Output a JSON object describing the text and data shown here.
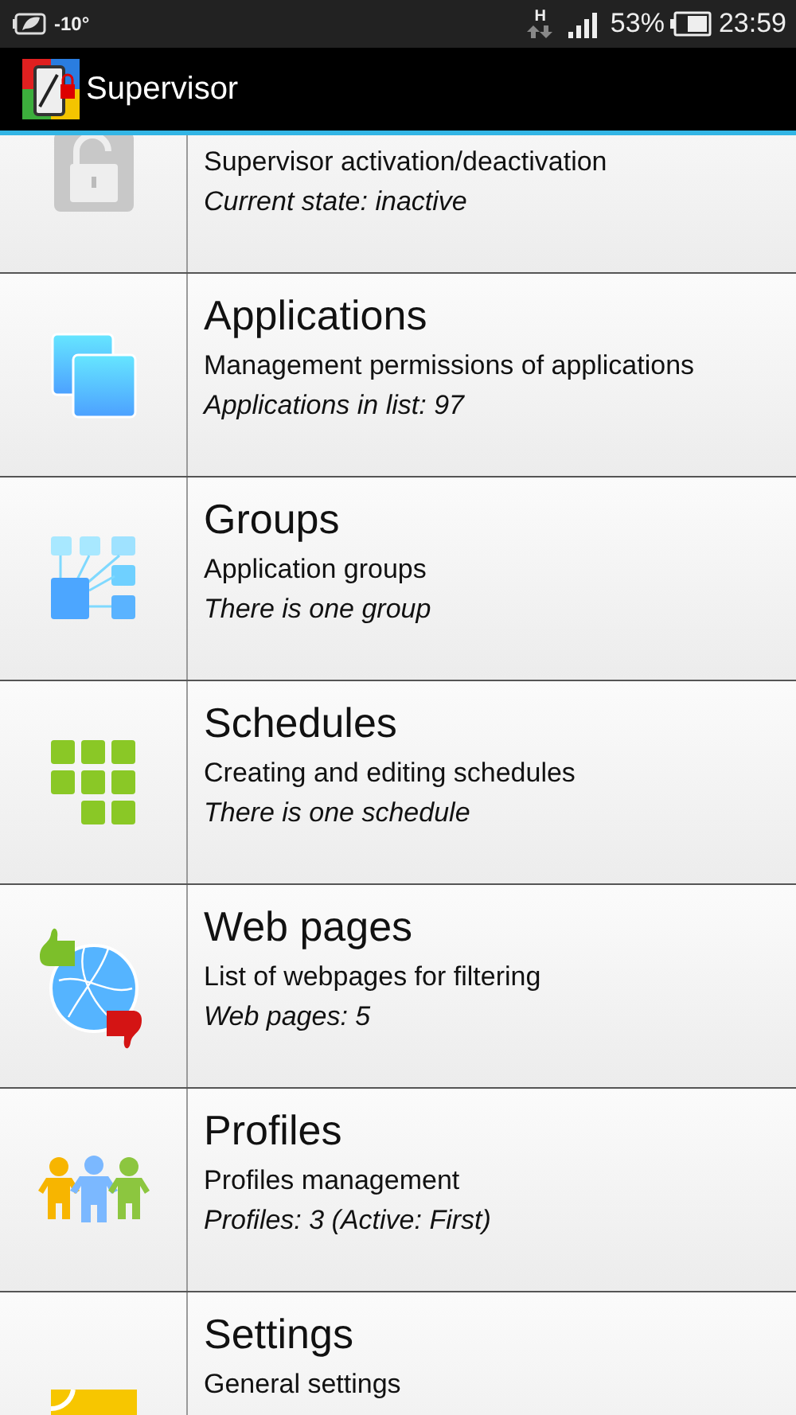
{
  "status_bar": {
    "temperature": "-10°",
    "network": "H",
    "battery": "53%",
    "time": "23:59"
  },
  "action_bar": {
    "title": "Supervisor"
  },
  "items": [
    {
      "kind": "lock",
      "subtitle": "Supervisor activation/deactivation",
      "detail": "Current state: inactive"
    },
    {
      "kind": "apps",
      "title": "Applications",
      "subtitle": "Management permissions of applications",
      "detail": "Applications in list: 97"
    },
    {
      "kind": "groups",
      "title": "Groups",
      "subtitle": "Application groups",
      "detail": "There is one group"
    },
    {
      "kind": "schedules",
      "title": "Schedules",
      "subtitle": "Creating and editing schedules",
      "detail": "There is one schedule"
    },
    {
      "kind": "web",
      "title": "Web pages",
      "subtitle": "List of webpages for filtering",
      "detail": "Web pages: 5"
    },
    {
      "kind": "profiles",
      "title": "Profiles",
      "subtitle": "Profiles management",
      "detail": "Profiles: 3 (Active: First)"
    },
    {
      "kind": "settings",
      "title": "Settings",
      "subtitle": "General settings"
    }
  ]
}
